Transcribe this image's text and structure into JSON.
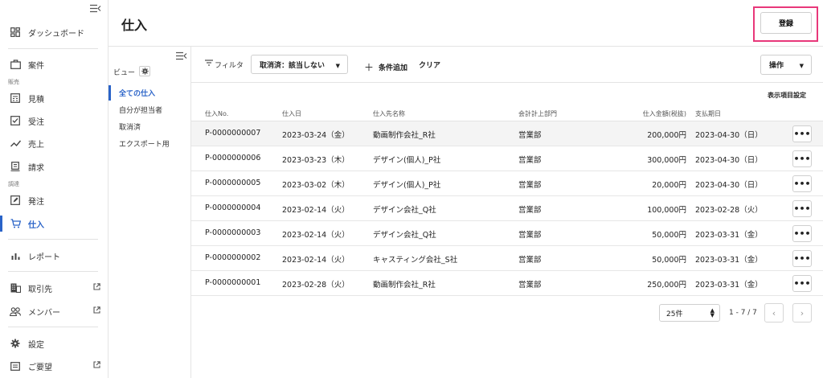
{
  "sidebar": {
    "dashboard": "ダッシュボード",
    "projects": "案件",
    "section_sales": "販売",
    "estimates": "見積",
    "orders": "受注",
    "sales": "売上",
    "billing": "請求",
    "section_procurement": "調達",
    "purchase_orders": "発注",
    "purchases": "仕入",
    "reports": "レポート",
    "clients": "取引先",
    "members": "メンバー",
    "settings": "設定",
    "requests": "ご要望"
  },
  "header": {
    "title": "仕入",
    "register_label": "登録"
  },
  "views": {
    "label": "ビュー",
    "items": [
      "全ての仕入",
      "自分が担当者",
      "取消済",
      "エクスポート用"
    ]
  },
  "filter": {
    "label": "フィルタ",
    "chip": "取消済：該当しない",
    "add_condition": "条件追加",
    "clear": "クリア",
    "operations": "操作"
  },
  "column_settings": "表示項目設定",
  "table": {
    "headers": {
      "no": "仕入No.",
      "date": "仕入日",
      "vendor": "仕入先名称",
      "dept": "会計計上部門",
      "amount": "仕入金額(税抜)",
      "due": "支払期日"
    },
    "rows": [
      {
        "no": "P-0000000007",
        "date": "2023-03-24（金）",
        "vendor": "動画制作会社_R社",
        "dept": "営業部",
        "amount": "200,000円",
        "due": "2023-04-30（日）"
      },
      {
        "no": "P-0000000006",
        "date": "2023-03-23（木）",
        "vendor": "デザイン(個人)_P社",
        "dept": "営業部",
        "amount": "300,000円",
        "due": "2023-04-30（日）"
      },
      {
        "no": "P-0000000005",
        "date": "2023-03-02（木）",
        "vendor": "デザイン(個人)_P社",
        "dept": "営業部",
        "amount": "20,000円",
        "due": "2023-04-30（日）"
      },
      {
        "no": "P-0000000004",
        "date": "2023-02-14（火）",
        "vendor": "デザイン会社_Q社",
        "dept": "営業部",
        "amount": "100,000円",
        "due": "2023-02-28（火）"
      },
      {
        "no": "P-0000000003",
        "date": "2023-02-14（火）",
        "vendor": "デザイン会社_Q社",
        "dept": "営業部",
        "amount": "50,000円",
        "due": "2023-03-31（金）"
      },
      {
        "no": "P-0000000002",
        "date": "2023-02-14（火）",
        "vendor": "キャスティング会社_S社",
        "dept": "営業部",
        "amount": "50,000円",
        "due": "2023-03-31（金）"
      },
      {
        "no": "P-0000000001",
        "date": "2023-02-28（火）",
        "vendor": "動画制作会社_R社",
        "dept": "営業部",
        "amount": "250,000円",
        "due": "2023-03-31（金）"
      }
    ],
    "more_label": "•••"
  },
  "pagination": {
    "page_size": "25件",
    "range": "1 - 7 / 7",
    "prev": "‹",
    "next": "›"
  },
  "colors": {
    "accent": "#2a63c8",
    "highlight_frame": "#e8387a"
  }
}
